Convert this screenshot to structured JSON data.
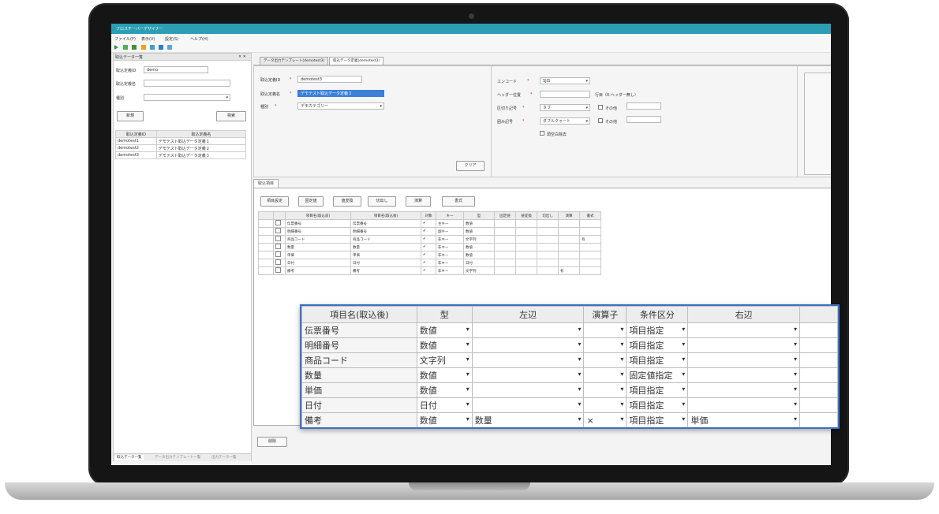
{
  "app": {
    "title": "フロスチーバーデザイナー",
    "menu": [
      "ファイル(F)",
      "表示(V)",
      "設定(S)",
      "ヘルプ(H)"
    ]
  },
  "left_panel": {
    "title": "取込データ一覧",
    "close": "× ✕",
    "id_label": "取込定義ID",
    "id_value": "demo",
    "name_label": "取込定義名",
    "name_value": "",
    "type_label": "種別",
    "type_value": "",
    "new_button": "新規",
    "search_button": "検索",
    "table": {
      "headers": [
        "取込定義ID",
        "取込定義名"
      ],
      "rows": [
        [
          "demotest1",
          "デモテスト取込データ定義１"
        ],
        [
          "demotest2",
          "デモテスト取込データ定義２"
        ],
        [
          "demotest3",
          "デモテスト取込データ定義３"
        ]
      ]
    },
    "bottom_tabs": [
      "取込データ一覧",
      "データ出力テンプレート一覧",
      "出力データ一覧"
    ]
  },
  "doc_tabs": [
    "データ出力テンプレート(demotest3)",
    "取込データ定義(demotest3)"
  ],
  "form": {
    "id_label": "取込定義ID",
    "id_value": "demotest3",
    "name_label": "取込定義名",
    "name_value": "デモテスト取込データ定義３",
    "type_label": "種別",
    "type_value": "デモカテゴリー",
    "required_mark": "*",
    "encoding_label": "エンコード",
    "encoding_value": "SJIS",
    "header_label": "ヘッダー位置",
    "header_value": "",
    "header_note": "行目（0:ヘッダー無し）",
    "delimiter_label": "区切り記号",
    "delimiter_value": "タブ",
    "other_label": "その他",
    "quote_label": "囲み記号",
    "quote_value": "ダブルクォート",
    "skip_label": "頭空白除去",
    "clear_button": "クリア"
  },
  "section": {
    "tab": "取込項目",
    "buttons": [
      "項目設定",
      "固定値",
      "値変換",
      "切出し",
      "演算",
      "書式"
    ],
    "grid": {
      "headers": [
        "",
        "",
        "項目名(取込前)",
        "項目名(取込後)",
        "対象",
        "キー",
        "型",
        "固定値",
        "値変換",
        "切出し",
        "演算",
        "書式"
      ],
      "rows": [
        [
          "伝票番号",
          "伝票番号",
          "✔",
          "主キー",
          "数値",
          "",
          "",
          "",
          "",
          ""
        ],
        [
          "明細番号",
          "明細番号",
          "✔",
          "副キー",
          "数値",
          "",
          "",
          "",
          "",
          ""
        ],
        [
          "商品コード",
          "商品コード",
          "✔",
          "非キー",
          "文字列",
          "",
          "",
          "",
          "",
          "有"
        ],
        [
          "数量",
          "数量",
          "✔",
          "非キー",
          "数値",
          "",
          "",
          "",
          "",
          ""
        ],
        [
          "単価",
          "単価",
          "✔",
          "非キー",
          "数値",
          "",
          "",
          "",
          "",
          ""
        ],
        [
          "日付",
          "日付",
          "✔",
          "非キー",
          "日付",
          "",
          "",
          "",
          "",
          ""
        ],
        [
          "備考",
          "備考",
          "✔",
          "非キー",
          "文字列",
          "",
          "",
          "",
          "有",
          ""
        ]
      ]
    },
    "bottom_button": "削除"
  },
  "zoom": {
    "headers": [
      "項目名(取込後)",
      "型",
      "左辺",
      "演算子",
      "条件区分",
      "右辺",
      ""
    ],
    "rows": [
      {
        "name": "伝票番号",
        "type": "数値",
        "left": "",
        "op": "",
        "cond": "項目指定",
        "right": ""
      },
      {
        "name": "明細番号",
        "type": "数値",
        "left": "",
        "op": "",
        "cond": "項目指定",
        "right": ""
      },
      {
        "name": "商品コード",
        "type": "文字列",
        "left": "",
        "op": "",
        "cond": "項目指定",
        "right": ""
      },
      {
        "name": "数量",
        "type": "数値",
        "left": "",
        "op": "",
        "cond": "固定値指定",
        "right": ""
      },
      {
        "name": "単価",
        "type": "数値",
        "left": "",
        "op": "",
        "cond": "項目指定",
        "right": ""
      },
      {
        "name": "日付",
        "type": "日付",
        "left": "",
        "op": "",
        "cond": "項目指定",
        "right": ""
      },
      {
        "name": "備考",
        "type": "数値",
        "left": "数量",
        "op": "×",
        "cond": "項目指定",
        "right": "単価"
      }
    ]
  },
  "colors": {
    "titlebar": "#2b9eb3",
    "zoom_border": "#3b6fc4"
  }
}
